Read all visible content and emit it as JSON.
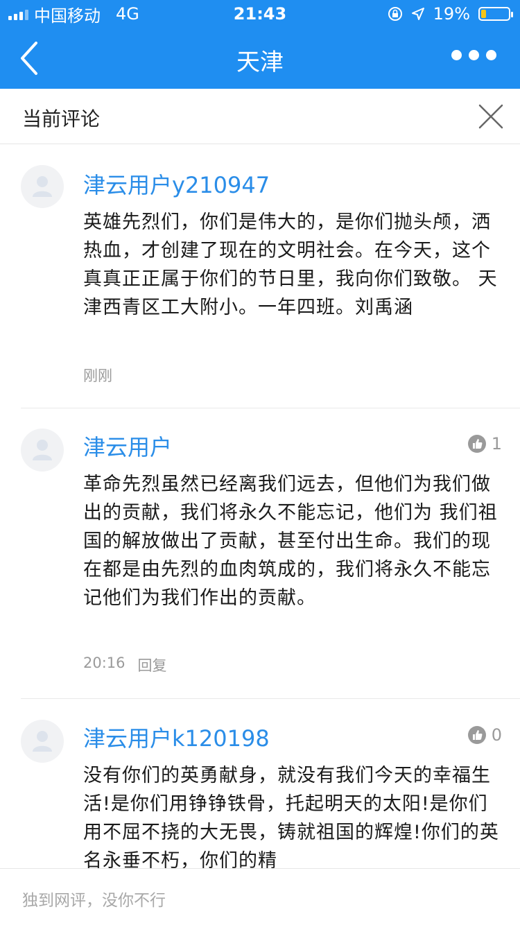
{
  "status_bar": {
    "carrier": "中国移动",
    "network": "4G",
    "time": "21:43",
    "battery_percent": "19%",
    "battery_level": 0.19,
    "icons": [
      "signal-icon",
      "lock-rotation-icon",
      "location-icon",
      "battery-icon"
    ]
  },
  "nav": {
    "title": "天津",
    "back_icon": "chevron-left-icon",
    "more_icon": "more-dots-icon"
  },
  "panel": {
    "title": "当前评论",
    "close_icon": "close-icon"
  },
  "comments": [
    {
      "user": "津云用户y210947",
      "text": "英雄先烈们，你们是伟大的，是你们抛头颅，洒热血，才创建了现在的文明社会。在今天，这个真真正正属于你们的节日里，我向你们致敬。 天津西青区工大附小。一年四班。刘禹涵",
      "time": "刚刚"
    },
    {
      "user": "津云用户",
      "text": "革命先烈虽然已经离我们远去，但他们为我们做出的贡献，我们将永久不能忘记，他们为 我们祖国的解放做出了贡献，甚至付出生命。我们的现在都是由先烈的血肉筑成的，我们将永久不能忘记他们为我们作出的贡献。",
      "time": "20:16",
      "reply": "回复",
      "likes": "1"
    },
    {
      "user": "津云用户k120198",
      "text": "没有你们的英勇献身，就没有我们今天的幸福生活!是你们用铮铮铁骨，托起明天的太阳!是你们用不屈不挠的大无畏，铸就祖国的辉煌!你们的英名永垂不朽，你们的精",
      "likes": "0"
    }
  ],
  "input": {
    "placeholder": "独到网评，没你不行"
  },
  "colors": {
    "primary": "#1f8ef1",
    "username": "#2a8de8",
    "meta": "#9a9a9a"
  }
}
